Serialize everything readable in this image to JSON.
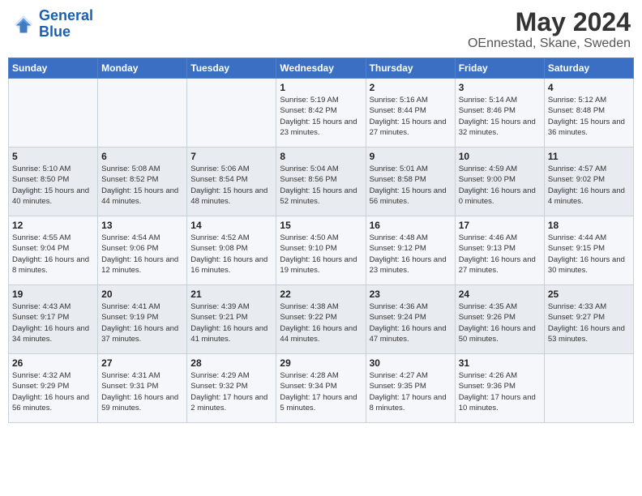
{
  "header": {
    "logo_text_general": "General",
    "logo_text_blue": "Blue",
    "month_year": "May 2024",
    "location": "OEnnestad, Skane, Sweden"
  },
  "days_of_week": [
    "Sunday",
    "Monday",
    "Tuesday",
    "Wednesday",
    "Thursday",
    "Friday",
    "Saturday"
  ],
  "weeks": [
    [
      {
        "day": "",
        "info": ""
      },
      {
        "day": "",
        "info": ""
      },
      {
        "day": "",
        "info": ""
      },
      {
        "day": "1",
        "info": "Sunrise: 5:19 AM\nSunset: 8:42 PM\nDaylight: 15 hours\nand 23 minutes."
      },
      {
        "day": "2",
        "info": "Sunrise: 5:16 AM\nSunset: 8:44 PM\nDaylight: 15 hours\nand 27 minutes."
      },
      {
        "day": "3",
        "info": "Sunrise: 5:14 AM\nSunset: 8:46 PM\nDaylight: 15 hours\nand 32 minutes."
      },
      {
        "day": "4",
        "info": "Sunrise: 5:12 AM\nSunset: 8:48 PM\nDaylight: 15 hours\nand 36 minutes."
      }
    ],
    [
      {
        "day": "5",
        "info": "Sunrise: 5:10 AM\nSunset: 8:50 PM\nDaylight: 15 hours\nand 40 minutes."
      },
      {
        "day": "6",
        "info": "Sunrise: 5:08 AM\nSunset: 8:52 PM\nDaylight: 15 hours\nand 44 minutes."
      },
      {
        "day": "7",
        "info": "Sunrise: 5:06 AM\nSunset: 8:54 PM\nDaylight: 15 hours\nand 48 minutes."
      },
      {
        "day": "8",
        "info": "Sunrise: 5:04 AM\nSunset: 8:56 PM\nDaylight: 15 hours\nand 52 minutes."
      },
      {
        "day": "9",
        "info": "Sunrise: 5:01 AM\nSunset: 8:58 PM\nDaylight: 15 hours\nand 56 minutes."
      },
      {
        "day": "10",
        "info": "Sunrise: 4:59 AM\nSunset: 9:00 PM\nDaylight: 16 hours\nand 0 minutes."
      },
      {
        "day": "11",
        "info": "Sunrise: 4:57 AM\nSunset: 9:02 PM\nDaylight: 16 hours\nand 4 minutes."
      }
    ],
    [
      {
        "day": "12",
        "info": "Sunrise: 4:55 AM\nSunset: 9:04 PM\nDaylight: 16 hours\nand 8 minutes."
      },
      {
        "day": "13",
        "info": "Sunrise: 4:54 AM\nSunset: 9:06 PM\nDaylight: 16 hours\nand 12 minutes."
      },
      {
        "day": "14",
        "info": "Sunrise: 4:52 AM\nSunset: 9:08 PM\nDaylight: 16 hours\nand 16 minutes."
      },
      {
        "day": "15",
        "info": "Sunrise: 4:50 AM\nSunset: 9:10 PM\nDaylight: 16 hours\nand 19 minutes."
      },
      {
        "day": "16",
        "info": "Sunrise: 4:48 AM\nSunset: 9:12 PM\nDaylight: 16 hours\nand 23 minutes."
      },
      {
        "day": "17",
        "info": "Sunrise: 4:46 AM\nSunset: 9:13 PM\nDaylight: 16 hours\nand 27 minutes."
      },
      {
        "day": "18",
        "info": "Sunrise: 4:44 AM\nSunset: 9:15 PM\nDaylight: 16 hours\nand 30 minutes."
      }
    ],
    [
      {
        "day": "19",
        "info": "Sunrise: 4:43 AM\nSunset: 9:17 PM\nDaylight: 16 hours\nand 34 minutes."
      },
      {
        "day": "20",
        "info": "Sunrise: 4:41 AM\nSunset: 9:19 PM\nDaylight: 16 hours\nand 37 minutes."
      },
      {
        "day": "21",
        "info": "Sunrise: 4:39 AM\nSunset: 9:21 PM\nDaylight: 16 hours\nand 41 minutes."
      },
      {
        "day": "22",
        "info": "Sunrise: 4:38 AM\nSunset: 9:22 PM\nDaylight: 16 hours\nand 44 minutes."
      },
      {
        "day": "23",
        "info": "Sunrise: 4:36 AM\nSunset: 9:24 PM\nDaylight: 16 hours\nand 47 minutes."
      },
      {
        "day": "24",
        "info": "Sunrise: 4:35 AM\nSunset: 9:26 PM\nDaylight: 16 hours\nand 50 minutes."
      },
      {
        "day": "25",
        "info": "Sunrise: 4:33 AM\nSunset: 9:27 PM\nDaylight: 16 hours\nand 53 minutes."
      }
    ],
    [
      {
        "day": "26",
        "info": "Sunrise: 4:32 AM\nSunset: 9:29 PM\nDaylight: 16 hours\nand 56 minutes."
      },
      {
        "day": "27",
        "info": "Sunrise: 4:31 AM\nSunset: 9:31 PM\nDaylight: 16 hours\nand 59 minutes."
      },
      {
        "day": "28",
        "info": "Sunrise: 4:29 AM\nSunset: 9:32 PM\nDaylight: 17 hours\nand 2 minutes."
      },
      {
        "day": "29",
        "info": "Sunrise: 4:28 AM\nSunset: 9:34 PM\nDaylight: 17 hours\nand 5 minutes."
      },
      {
        "day": "30",
        "info": "Sunrise: 4:27 AM\nSunset: 9:35 PM\nDaylight: 17 hours\nand 8 minutes."
      },
      {
        "day": "31",
        "info": "Sunrise: 4:26 AM\nSunset: 9:36 PM\nDaylight: 17 hours\nand 10 minutes."
      },
      {
        "day": "",
        "info": ""
      }
    ]
  ]
}
